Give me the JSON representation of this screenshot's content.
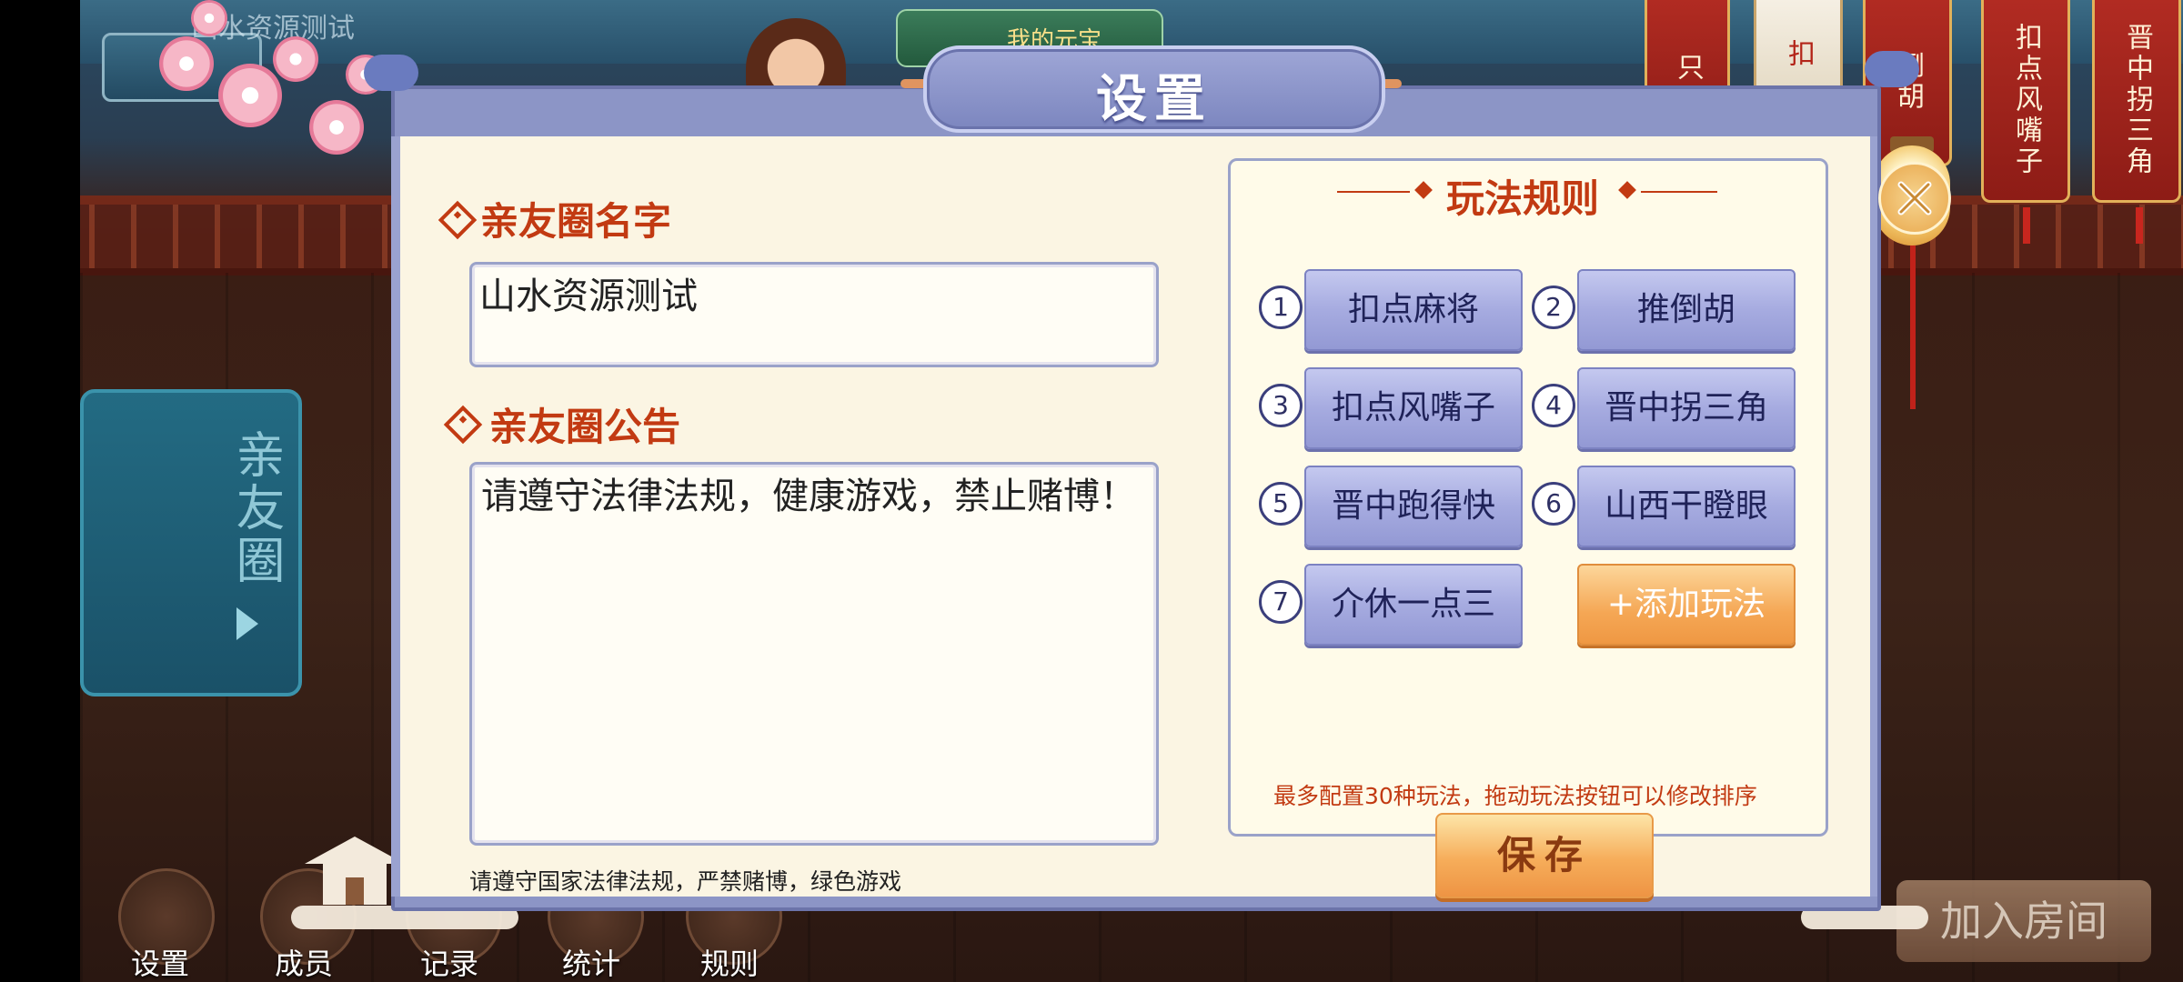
{
  "background": {
    "club_name": "山水资源测试",
    "coins_label": "我的元宝",
    "banners": [
      "只",
      "扣",
      "倒胡",
      "扣点风嘴子",
      "晋中拐三角"
    ],
    "side_panel_label": "亲友圈",
    "bottom_nav": [
      "设置",
      "成员",
      "记录",
      "统计",
      "规则"
    ],
    "join_room": "加入房间"
  },
  "dialog": {
    "title": "设置",
    "name_section": {
      "label": "亲友圈名字",
      "value": "山水资源测试"
    },
    "notice_section": {
      "label": "亲友圈公告",
      "value": "请遵守法律法规，健康游戏，禁止赌博！"
    },
    "footnote": "请遵守国家法律法规，严禁赌博，绿色游戏",
    "rules": {
      "title": "玩法规则",
      "items": [
        {
          "num": "1",
          "label": "扣点麻将"
        },
        {
          "num": "2",
          "label": "推倒胡"
        },
        {
          "num": "3",
          "label": "扣点风嘴子"
        },
        {
          "num": "4",
          "label": "晋中拐三角"
        },
        {
          "num": "5",
          "label": "晋中跑得快"
        },
        {
          "num": "6",
          "label": "山西干瞪眼"
        },
        {
          "num": "7",
          "label": "介休一点三"
        }
      ],
      "add_label": "+添加玩法",
      "hint": "最多配置30种玩法，拖动玩法按钮可以修改排序"
    },
    "save_label": "保存"
  },
  "colors": {
    "accent_red": "#c23a12",
    "dialog_purple": "#8c95c6",
    "paper": "#fbf5e3",
    "button_lilac": "#a6abe0",
    "button_orange": "#f5a755"
  }
}
